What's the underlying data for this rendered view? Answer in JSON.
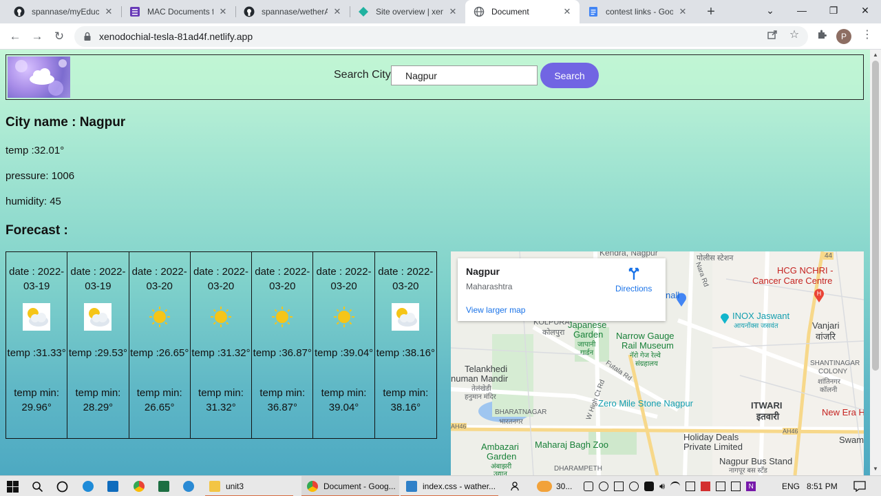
{
  "browser": {
    "tabs": [
      {
        "title": "spannase/myEduca",
        "icon": "github-icon"
      },
      {
        "title": "MAC Documents fo",
        "icon": "forms-icon"
      },
      {
        "title": "spannase/wetherAp",
        "icon": "github-icon"
      },
      {
        "title": "Site overview | xenc",
        "icon": "netlify-icon"
      },
      {
        "title": "Document",
        "icon": "globe-icon"
      },
      {
        "title": "contest links - Goo",
        "icon": "docs-icon"
      }
    ],
    "url": "xenodochial-tesla-81ad4f.netlify.app",
    "profile_initial": "P"
  },
  "header": {
    "search_label": "Search City",
    "search_value": "Nagpur",
    "search_button": "Search"
  },
  "current": {
    "city_line": "City name : Nagpur",
    "temp": "temp :32.01°",
    "pressure": "pressure: 1006",
    "humidity": "humidity: 45"
  },
  "forecast_title": "Forecast :",
  "forecast": [
    {
      "date": "date : 2022-03-19",
      "icon": "cloud-sun-icon",
      "temp": "temp :31.33°",
      "min": "temp min: 29.96°"
    },
    {
      "date": "date : 2022-03-19",
      "icon": "cloud-sun-icon",
      "temp": "temp :29.53°",
      "min": "temp min: 28.29°"
    },
    {
      "date": "date : 2022-03-20",
      "icon": "sun-icon",
      "temp": "temp :26.65°",
      "min": "temp min: 26.65°"
    },
    {
      "date": "date : 2022-03-20",
      "icon": "sun-icon",
      "temp": "temp :31.32°",
      "min": "temp min: 31.32°"
    },
    {
      "date": "date : 2022-03-20",
      "icon": "sun-icon",
      "temp": "temp :36.87°",
      "min": "temp min: 36.87°"
    },
    {
      "date": "date : 2022-03-20",
      "icon": "sun-icon",
      "temp": "temp :39.04°",
      "min": "temp min: 39.04°"
    },
    {
      "date": "date : 2022-03-20",
      "icon": "cloud-sun-icon",
      "temp": "temp :38.16°",
      "min": "temp min: 38.16°"
    }
  ],
  "map": {
    "place": "Nagpur",
    "region": "Maharashtra",
    "directions": "Directions",
    "larger": "View larger map",
    "labels": {
      "kendra": "Kendra, Nagpur",
      "police": "पोलीस स्टेशन",
      "hcg1": "HCG NCHRI -",
      "hcg2": "Cancer Care Centre",
      "inox1": "INOX Jaswant",
      "inox2": "आयनॉक्स जसवंत",
      "vanjari1": "Vanjari",
      "vanjari2": "वांजरि",
      "kolpura1": "KOLPURA",
      "kolpura2": "कोलपुरा",
      "japanese1": "Japanese",
      "japanese2": "Garden",
      "japanese3": "जापानी",
      "japanese4": "गार्डन",
      "narrow1": "Narrow Gauge",
      "narrow2": "Rail Museum",
      "narrow3": "नॅरो गेज रेल्वे",
      "narrow4": "संग्रहालय",
      "telankhedi1": "Telankhedi",
      "telankhedi2": "numan Mandir",
      "telankhedi3": "तेलंखेडी",
      "telankhedi4": "हनुमान मंदिर",
      "shanti1": "SHANTINAGAR",
      "shanti2": "COLONY",
      "shanti3": "शांतिनगर",
      "shanti4": "कॉलनी",
      "zero": "Zero Mile Stone Nagpur",
      "itwari1": "ITWARI",
      "itwari2": "इतवारी",
      "newera": "New Era H",
      "bharat1": "BHARATNAGAR",
      "bharat2": "भारतनगर",
      "holiday1": "Holiday Deals",
      "holiday2": "Private Limited",
      "swamina": "Swamina",
      "ambazari1": "Ambazari",
      "ambazari2": "Garden",
      "ambazari3": "अंबाझरी",
      "ambazari4": "उद्यान",
      "maharaj": "Maharaj Bagh Zoo",
      "busstand1": "Nagpur Bus Stand",
      "busstand2": "नागपूर बस स्टँड",
      "dharampeth": "DHARAMPETH",
      "ah46a": "AH46",
      "ah46b": "AH46",
      "road44": "44",
      "nara": "Nara Rd",
      "futala": "Futala Rd",
      "whigh": "W High Ct Rd",
      "nall": "nall"
    }
  },
  "taskbar": {
    "items": [
      {
        "label": "unit3"
      },
      {
        "label": "Document - Goog..."
      },
      {
        "label": "index.css - wather..."
      }
    ],
    "weather_temp": "30...",
    "lang": "ENG",
    "time": "8:51 PM"
  },
  "colors": {
    "search_button": "#7165e3",
    "accent_blue": "#1a73e8"
  }
}
